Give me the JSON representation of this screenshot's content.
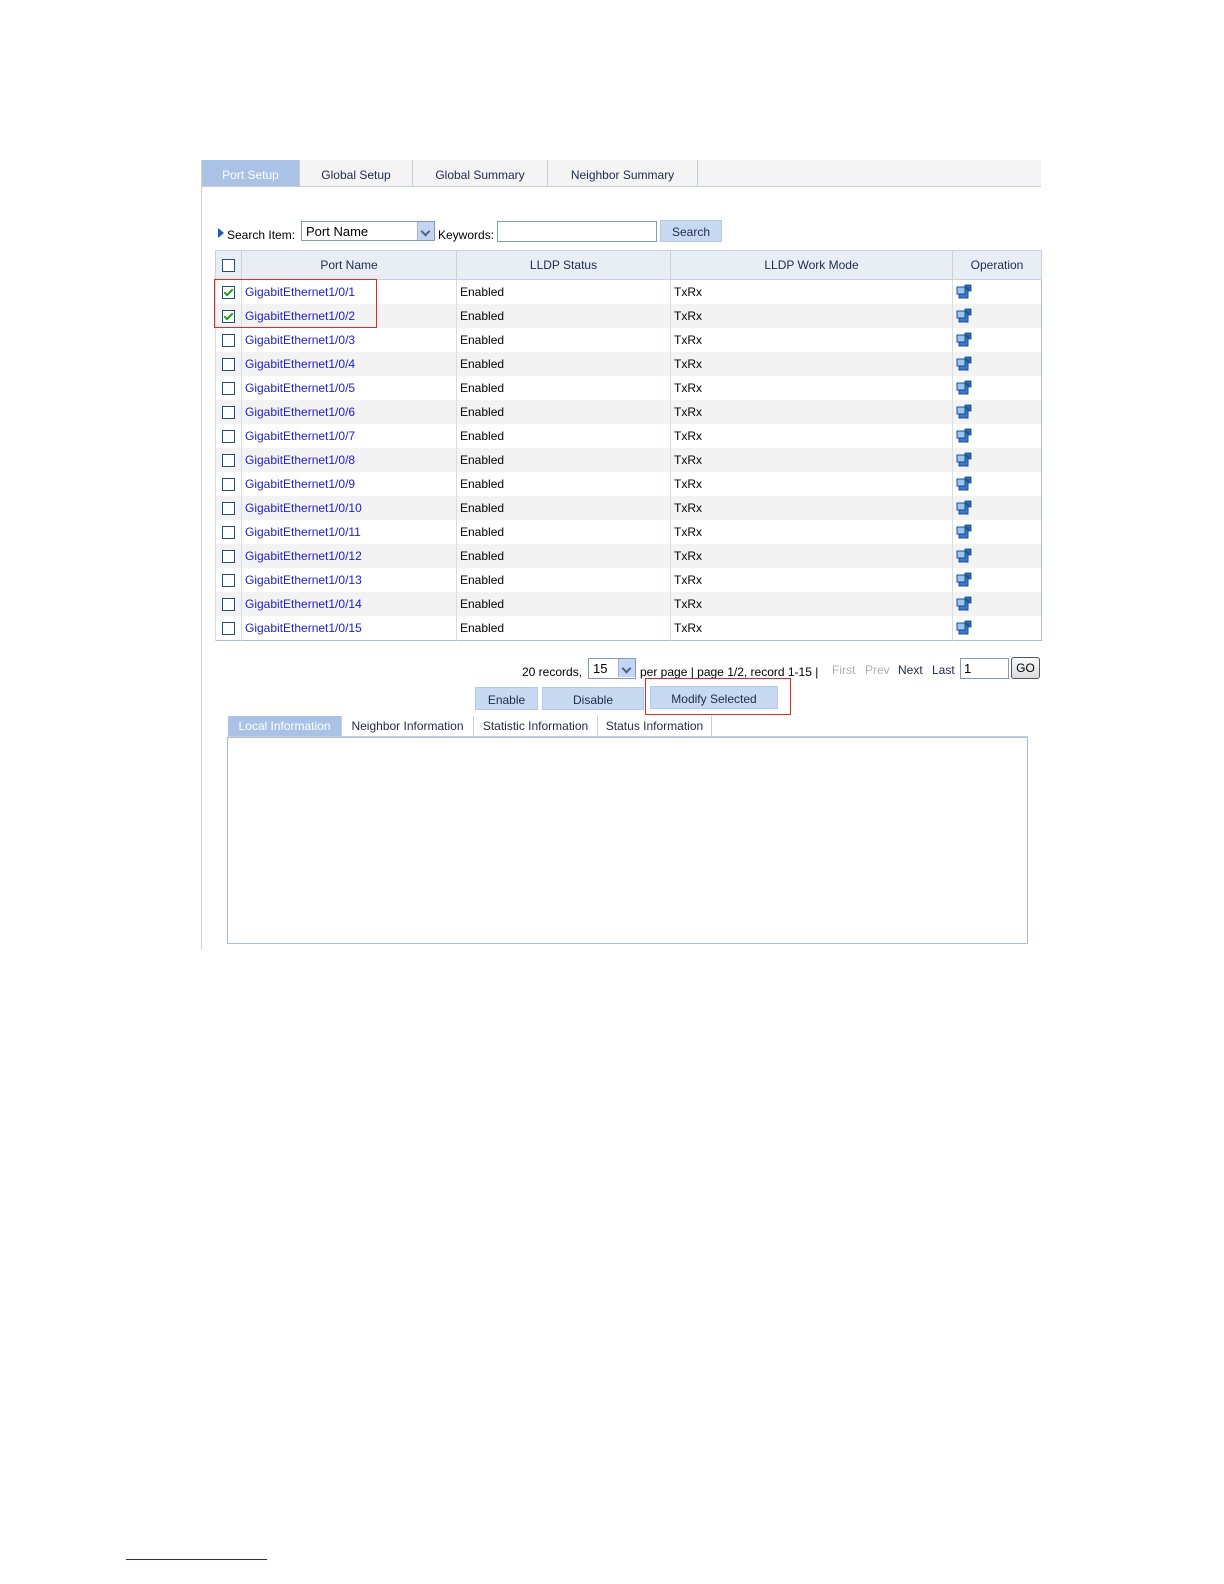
{
  "top_tabs": [
    {
      "label": "Port Setup"
    },
    {
      "label": "Global Setup"
    },
    {
      "label": "Global Summary"
    },
    {
      "label": "Neighbor Summary"
    }
  ],
  "search": {
    "item_label": "Search Item:",
    "item_value": "Port Name",
    "keywords_label": "Keywords:",
    "keywords_value": "",
    "button_label": "Search"
  },
  "table": {
    "headers": [
      "Port Name",
      "LLDP Status",
      "LLDP Work Mode",
      "Operation"
    ],
    "rows": [
      {
        "checked": true,
        "port": "GigabitEthernet1/0/1",
        "status": "Enabled",
        "mode": "TxRx"
      },
      {
        "checked": true,
        "port": "GigabitEthernet1/0/2",
        "status": "Enabled",
        "mode": "TxRx"
      },
      {
        "checked": false,
        "port": "GigabitEthernet1/0/3",
        "status": "Enabled",
        "mode": "TxRx"
      },
      {
        "checked": false,
        "port": "GigabitEthernet1/0/4",
        "status": "Enabled",
        "mode": "TxRx"
      },
      {
        "checked": false,
        "port": "GigabitEthernet1/0/5",
        "status": "Enabled",
        "mode": "TxRx"
      },
      {
        "checked": false,
        "port": "GigabitEthernet1/0/6",
        "status": "Enabled",
        "mode": "TxRx"
      },
      {
        "checked": false,
        "port": "GigabitEthernet1/0/7",
        "status": "Enabled",
        "mode": "TxRx"
      },
      {
        "checked": false,
        "port": "GigabitEthernet1/0/8",
        "status": "Enabled",
        "mode": "TxRx"
      },
      {
        "checked": false,
        "port": "GigabitEthernet1/0/9",
        "status": "Enabled",
        "mode": "TxRx"
      },
      {
        "checked": false,
        "port": "GigabitEthernet1/0/10",
        "status": "Enabled",
        "mode": "TxRx"
      },
      {
        "checked": false,
        "port": "GigabitEthernet1/0/11",
        "status": "Enabled",
        "mode": "TxRx"
      },
      {
        "checked": false,
        "port": "GigabitEthernet1/0/12",
        "status": "Enabled",
        "mode": "TxRx"
      },
      {
        "checked": false,
        "port": "GigabitEthernet1/0/13",
        "status": "Enabled",
        "mode": "TxRx"
      },
      {
        "checked": false,
        "port": "GigabitEthernet1/0/14",
        "status": "Enabled",
        "mode": "TxRx"
      },
      {
        "checked": false,
        "port": "GigabitEthernet1/0/15",
        "status": "Enabled",
        "mode": "TxRx"
      }
    ],
    "operation_icon": "modify-icon"
  },
  "pager": {
    "records_text": "20 records,",
    "page_size": "15",
    "summary_text": "per page | page 1/2, record 1-15 |",
    "first": "First",
    "prev": "Prev",
    "next": "Next",
    "last": "Last",
    "page_input": "1",
    "go": "GO"
  },
  "actions": {
    "enable": "Enable",
    "disable": "Disable",
    "modify_selected": "Modify Selected"
  },
  "bottom_tabs": [
    {
      "label": "Local Information"
    },
    {
      "label": "Neighbor Information"
    },
    {
      "label": "Statistic Information"
    },
    {
      "label": "Status Information"
    }
  ],
  "colors": {
    "active_tab": "#a9c2e6",
    "highlight": "#e5262b",
    "link": "#1d1dcc"
  }
}
